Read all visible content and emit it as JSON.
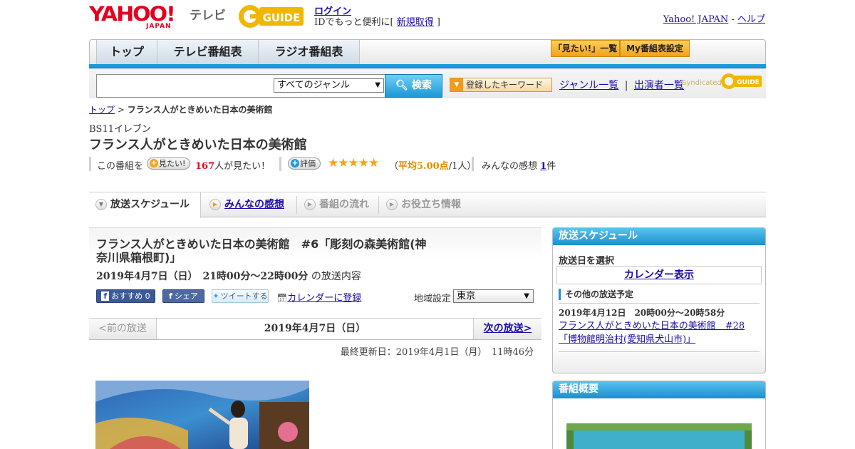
{
  "header": {
    "logo_text": "YAHOO!",
    "logo_sub": "JAPAN",
    "service_name": "テレビ",
    "gguide_logo": "G GUIDE",
    "login_label": "ログイン",
    "login_sub_prefix": "IDでもっと便利に[ ",
    "register_label": "新規取得",
    "login_sub_suffix": " ]",
    "yahoo_japan_link": "Yahoo! JAPAN",
    "separator": " - ",
    "help_link": "ヘルプ"
  },
  "nav": {
    "tabs": [
      {
        "label": "トップ"
      },
      {
        "label": "テレビ番組表"
      },
      {
        "label": "ラジオ番組表"
      }
    ],
    "mitai_list": "「見たい!」一覧",
    "my_schedule": "My番組表設定"
  },
  "search": {
    "placeholder": "",
    "genre_selected": "すべてのジャンル",
    "search_button": "検索",
    "keyword_button": "登録したキーワード",
    "genre_list": "ジャンル一覧",
    "divider": "|",
    "performer_list": "出演者一覧",
    "syndicated": "Syndicated"
  },
  "breadcrumb": {
    "top": "トップ",
    "sep": " > ",
    "current": "フランス人がときめいた日本の美術館"
  },
  "program": {
    "channel": "BS11イレブン",
    "title": "フランス人がときめいた日本の美術館",
    "this_program": "この番組を",
    "mitai_button": "見たい!",
    "mitai_count": "167",
    "mitai_suffix": "人が見たい！",
    "rating_button": "評価",
    "stars": "★★★★★",
    "rating_open": "（",
    "rating_avg_label": "平均5.00点",
    "rating_count": "/1人",
    "rating_close": "）",
    "reviews_label": "みんなの感想",
    "reviews_count": "1",
    "reviews_suffix": "件"
  },
  "content_tabs": [
    {
      "label": "放送スケジュール",
      "state": "active"
    },
    {
      "label": "みんなの感想",
      "state": "link"
    },
    {
      "label": "番組の流れ",
      "state": "disabled"
    },
    {
      "label": "お役立ち情報",
      "state": "disabled"
    }
  ],
  "episode": {
    "title": "フランス人がときめいた日本の美術館　#6「彫刻の森美術館(神奈川県箱根町)」",
    "datetime": "2019年4月7日（日）　21時00分～22時00分",
    "datetime_suffix": "の放送内容",
    "fb_recommend": "おすすめ 0",
    "fb_share": "シェア",
    "tweet": "ツイートする",
    "calendar_register": "カレンダーに登録",
    "region_label": "地域設定",
    "region_selected": "東京"
  },
  "pager": {
    "prev": "<前の放送",
    "current": "2019年4月7日（日）",
    "next": "次の放送>"
  },
  "updated": "最終更新日：2019年4月1日（月）　11時46分",
  "sidebar": {
    "schedule_header": "放送スケジュール",
    "select_date": "放送日を選択",
    "calendar_button": "カレンダー表示",
    "other_header": "その他の放送予定",
    "other_date": "2019年4月12日　20時00分～20時58分",
    "other_title": "フランス人がときめいた日本の美術館　#28「博物館明治村(愛知県犬山市)」",
    "summary_header": "番組概要"
  },
  "colors": {
    "accent_blue": "#1a9ad6",
    "yahoo_red": "#e4001e",
    "star_orange": "#f2a417",
    "link": "#1a0dab",
    "mitai_count": "#e4001e"
  }
}
